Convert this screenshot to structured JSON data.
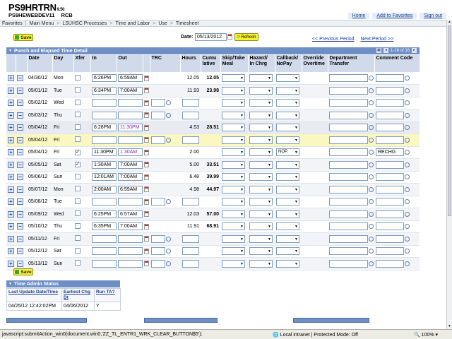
{
  "header": {
    "logo_main": "PS9HRTRN",
    "logo_version": "9.50",
    "logo_sub": "PS9HEWEBDEV11",
    "logo_user": "RCB",
    "links": [
      "Home",
      "Add to Favorites",
      "Sign out"
    ]
  },
  "nav": {
    "items": [
      "Favorites",
      "Main Menu",
      "LSUHSC Processes",
      "Time and Labor",
      "Use",
      "Timesheet"
    ]
  },
  "toolbar": {
    "save_label": "Save",
    "date_label": "Date:",
    "date_value": "05/13/2012",
    "refresh_label": "Refresh",
    "prev_period": "<< Previous Period",
    "next_period": "Next Period >>"
  },
  "grid": {
    "title": "Punch and Elapsed Time Detail",
    "pager": "1-16 of 16",
    "columns": [
      "Date",
      "Day",
      "Xfer",
      "In",
      "Out",
      "TRC",
      "Hours",
      "Cumu lative",
      "Skip/Take Meal",
      "Hazard/ In Chrg",
      "Callback/ NoPay",
      "Override Overtime",
      "Department Transfer",
      "Comment Code"
    ],
    "rows": [
      {
        "date": "04/30/12",
        "day": "Mon",
        "xfer": false,
        "in": "6:26PM",
        "out": "6:59AM",
        "hours": "12.05",
        "cum": "12.05",
        "callback": "",
        "comment": "",
        "style": "odd",
        "out_purple": false,
        "trc_input": false
      },
      {
        "date": "05/01/12",
        "day": "Tue",
        "xfer": false,
        "in": "6:34PM",
        "out": "7:00AM",
        "hours": "11.93",
        "cum": "23.98",
        "callback": "",
        "comment": "",
        "style": "even",
        "out_purple": false,
        "trc_input": false
      },
      {
        "date": "05/02/12",
        "day": "Wed",
        "xfer": false,
        "in": "",
        "out": "",
        "hours": "",
        "cum": "",
        "callback": "",
        "comment": "",
        "style": "odd",
        "out_purple": false,
        "trc_input": true
      },
      {
        "date": "05/03/12",
        "day": "Thu",
        "xfer": false,
        "in": "",
        "out": "",
        "hours": "",
        "cum": "",
        "callback": "",
        "comment": "",
        "style": "even",
        "out_purple": false,
        "trc_input": true
      },
      {
        "date": "05/04/12",
        "day": "Fri",
        "xfer": false,
        "in": "6:28PM",
        "out": "11:30PM",
        "hours": "4.53",
        "cum": "28.51",
        "callback": "",
        "comment": "",
        "style": "grey",
        "out_purple": true,
        "trc_input": false
      },
      {
        "date": "05/04/12",
        "day": "Fri",
        "xfer": false,
        "in": "",
        "out": "",
        "hours": "",
        "cum": "",
        "callback": "",
        "comment": "",
        "style": "sel",
        "out_purple": false,
        "trc_input": true
      },
      {
        "date": "05/04/12",
        "day": "Fri",
        "xfer": true,
        "in": "11:30PM",
        "out": "1:30AM",
        "hours": "2.00",
        "cum": "",
        "callback": "NOP.",
        "comment": "RECHG",
        "style": "odd",
        "out_purple": true,
        "trc_input": false
      },
      {
        "date": "05/05/12",
        "day": "Sat",
        "xfer": true,
        "in": "1:30AM",
        "out": "7:00AM",
        "hours": "5.00",
        "cum": "33.51",
        "callback": "",
        "comment": "",
        "style": "even",
        "out_purple": false,
        "trc_input": false
      },
      {
        "date": "05/06/12",
        "day": "Sun",
        "xfer": false,
        "in": "12:01AM",
        "out": "7:00AM",
        "hours": "6.48",
        "cum": "39.99",
        "callback": "",
        "comment": "",
        "style": "odd",
        "out_purple": false,
        "trc_input": false
      },
      {
        "date": "05/07/12",
        "day": "Mon",
        "xfer": false,
        "in": "2:00AM",
        "out": "6:59AM",
        "hours": "4.98",
        "cum": "44.97",
        "callback": "",
        "comment": "",
        "style": "even",
        "out_purple": false,
        "trc_input": false
      },
      {
        "date": "05/08/12",
        "day": "Tue",
        "xfer": false,
        "in": "",
        "out": "",
        "hours": "",
        "cum": "",
        "callback": "",
        "comment": "",
        "style": "odd",
        "out_purple": false,
        "trc_input": true
      },
      {
        "date": "05/09/12",
        "day": "Wed",
        "xfer": false,
        "in": "6:25PM",
        "out": "6:57AM",
        "hours": "12.03",
        "cum": "57.00",
        "callback": "",
        "comment": "",
        "style": "even",
        "out_purple": false,
        "trc_input": false
      },
      {
        "date": "05/10/12",
        "day": "Thu",
        "xfer": false,
        "in": "6:35PM",
        "out": "7:00AM",
        "hours": "11.91",
        "cum": "68.91",
        "callback": "",
        "comment": "",
        "style": "odd",
        "out_purple": false,
        "trc_input": false
      },
      {
        "date": "05/11/12",
        "day": "Fri",
        "xfer": false,
        "in": "",
        "out": "",
        "hours": "",
        "cum": "",
        "callback": "",
        "comment": "",
        "style": "even",
        "out_purple": false,
        "trc_input": true
      },
      {
        "date": "05/12/12",
        "day": "Sat",
        "xfer": false,
        "in": "",
        "out": "",
        "hours": "",
        "cum": "",
        "callback": "",
        "comment": "",
        "style": "odd",
        "out_purple": false,
        "trc_input": true
      },
      {
        "date": "05/13/12",
        "day": "Sun",
        "xfer": false,
        "in": "",
        "out": "",
        "hours": "",
        "cum": "",
        "callback": "",
        "comment": "",
        "style": "even",
        "out_purple": false,
        "trc_input": true
      }
    ]
  },
  "time_admin": {
    "title": "Time Admin Status",
    "headers": [
      "Last Update Date/Time",
      "Earliest Chg Dt",
      "Run TA?"
    ],
    "values": [
      "04/25/12 12:42:02PM",
      "04/06/2012",
      "Y"
    ]
  },
  "statusbar": {
    "text": "javascript:submitAction_win0(document.win0,'ZZ_TL_ENTR1_WRK_CLEAR_BUTTON$5');",
    "zone": "Local intranet | Protected Mode: Off",
    "zoom": "100%"
  },
  "colors": {
    "grid_header": "#6e8fc6",
    "column_header": "#d0daea",
    "selected_row": "#fbf7c0",
    "save_button": "#f8f230",
    "link": "#1a3c96",
    "purple_time": "#8a2bbf"
  }
}
